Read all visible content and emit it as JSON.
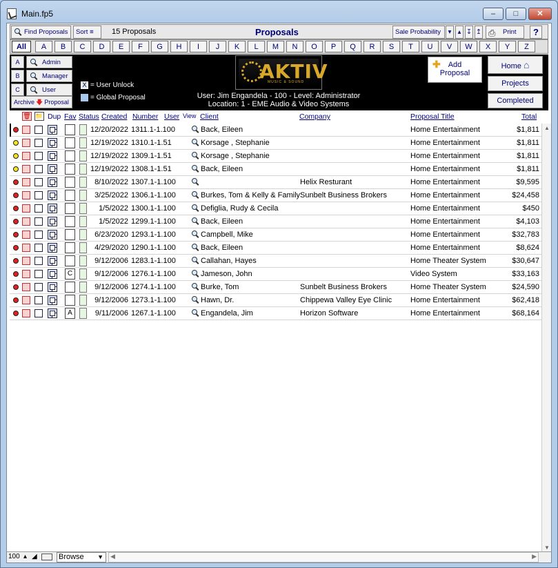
{
  "window": {
    "title": "Main.fp5"
  },
  "toolbar": {
    "find_label": "Find Proposals",
    "sort_label": "Sort",
    "count": "15 Proposals",
    "title": "Proposals",
    "sale_prob_label": "Sale Probability",
    "print_label": "Print",
    "help_label": "?"
  },
  "alphabet": [
    "All",
    "A",
    "B",
    "C",
    "D",
    "E",
    "F",
    "G",
    "H",
    "I",
    "J",
    "K",
    "L",
    "M",
    "N",
    "O",
    "P",
    "Q",
    "R",
    "S",
    "T",
    "U",
    "V",
    "W",
    "X",
    "Y",
    "Z"
  ],
  "header": {
    "levels": [
      "A",
      "B",
      "C"
    ],
    "roles": [
      "Admin",
      "Manager",
      "User"
    ],
    "archive_label": "Archive",
    "proposal_label": "Proposal",
    "legend_unlock": "= User Unlock",
    "legend_global": "= Global Proposal",
    "logo_text": "AKTIV",
    "logo_sub": "MUSIC & SOUND",
    "user_line": "User: Jim Engandela - 100 - Level: Administrator",
    "location_line": "Location: 1 - EME Audio & Video Systems",
    "add_label_1": "Add",
    "add_label_2": "Proposal",
    "nav": [
      "Home",
      "Projects",
      "Completed"
    ]
  },
  "columns": {
    "dup": "Dup",
    "fav": "Fav",
    "status": "Status",
    "created": "Created",
    "number": "Number",
    "user": "User",
    "view": "View",
    "client": "Client",
    "company": "Company",
    "title": "Proposal Title",
    "total": "Total"
  },
  "colors": {
    "red_dot": "#e02020",
    "yellow_dot": "#f4e520"
  },
  "rows": [
    {
      "dot": "red",
      "fav": "",
      "created": "12/20/2022",
      "number": "1311.1-1.100",
      "client": "Back, Eileen",
      "company": "",
      "title": "Home Entertainment",
      "total": "$1,811",
      "selected": true
    },
    {
      "dot": "yellow",
      "fav": "",
      "created": "12/19/2022",
      "number": "1310.1-1.51",
      "client": "Korsage , Stephanie",
      "company": "",
      "title": "Home Entertainment",
      "total": "$1,811"
    },
    {
      "dot": "yellow",
      "fav": "",
      "created": "12/19/2022",
      "number": "1309.1-1.51",
      "client": "Korsage , Stephanie",
      "company": "",
      "title": "Home Entertainment",
      "total": "$1,811"
    },
    {
      "dot": "yellow",
      "fav": "",
      "created": "12/19/2022",
      "number": "1308.1-1.51",
      "client": "Back, Eileen",
      "company": "",
      "title": "Home Entertainment",
      "total": "$1,811"
    },
    {
      "dot": "red",
      "fav": "",
      "created": "8/10/2022",
      "number": "1307.1-1.100",
      "client": "",
      "company": "Helix Resturant",
      "title": "Home Entertainment",
      "total": "$9,595"
    },
    {
      "dot": "red",
      "fav": "",
      "created": "3/25/2022",
      "number": "1306.1-1.100",
      "client": "Burkes, Tom & Kelly & Family",
      "company": "Sunbelt Business Brokers",
      "title": "Home Entertainment",
      "total": "$24,458"
    },
    {
      "dot": "red",
      "fav": "",
      "created": "1/5/2022",
      "number": "1300.1-1.100",
      "client": "Defiglia, Rudy & Cecila",
      "company": "",
      "title": "Home Entertainment",
      "total": "$450"
    },
    {
      "dot": "red",
      "fav": "",
      "created": "1/5/2022",
      "number": "1299.1-1.100",
      "client": "Back, Eileen",
      "company": "",
      "title": "Home Entertainment",
      "total": "$4,103"
    },
    {
      "dot": "red",
      "fav": "",
      "created": "6/23/2020",
      "number": "1293.1-1.100",
      "client": "Campbell, Mike",
      "company": "",
      "title": "Home Entertainment",
      "total": "$32,783"
    },
    {
      "dot": "red",
      "fav": "",
      "created": "4/29/2020",
      "number": "1290.1-1.100",
      "client": "Back, Eileen",
      "company": "",
      "title": "Home Entertainment",
      "total": "$8,624"
    },
    {
      "dot": "red",
      "fav": "",
      "created": "9/12/2006",
      "number": "1283.1-1.100",
      "client": "Callahan, Hayes",
      "company": "",
      "title": "Home Theater System",
      "total": "$30,647"
    },
    {
      "dot": "red",
      "fav": "C",
      "created": "9/12/2006",
      "number": "1276.1-1.100",
      "client": "Jameson, John",
      "company": "",
      "title": "Video System",
      "total": "$33,163"
    },
    {
      "dot": "red",
      "fav": "",
      "created": "9/12/2006",
      "number": "1274.1-1.100",
      "client": "Burke, Tom",
      "company": "Sunbelt Business Brokers",
      "title": "Home Theater System",
      "total": "$24,590"
    },
    {
      "dot": "red",
      "fav": "",
      "created": "9/12/2006",
      "number": "1273.1-1.100",
      "client": "Hawn, Dr.",
      "company": "Chippewa Valley Eye Clinic",
      "title": "Home Entertainment",
      "total": "$62,418"
    },
    {
      "dot": "red",
      "fav": "A",
      "created": "9/11/2006",
      "number": "1267.1-1.100",
      "client": "Engandela, Jim",
      "company": "Horizon Software",
      "title": "Home Entertainment",
      "total": "$68,164"
    }
  ],
  "statusbar": {
    "zoom": "100",
    "mode": "Browse"
  }
}
